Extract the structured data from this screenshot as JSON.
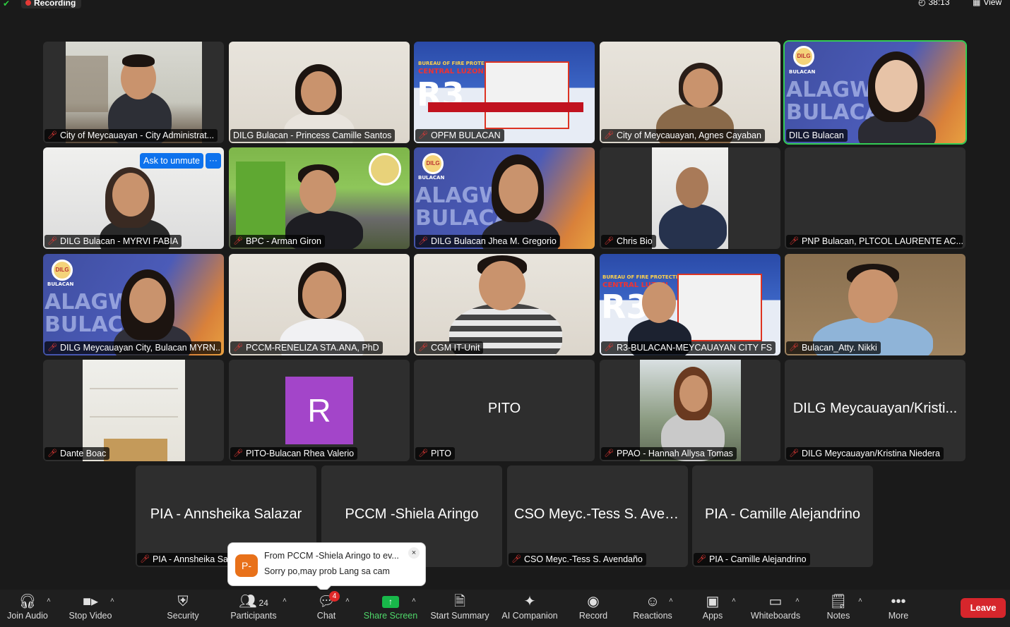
{
  "topbar": {
    "recording_label": "Recording",
    "timer": "38:13",
    "view_label": "View"
  },
  "tiles": [
    {
      "name": "City of Meycauayan - City Administrat...",
      "muted": true
    },
    {
      "name": "DILG Bulacan - Princess Camille Santos",
      "muted": false
    },
    {
      "name": "OPFM BULACAN",
      "muted": true
    },
    {
      "name": "City of Meycauayan, Agnes Cayaban",
      "muted": true
    },
    {
      "name": "DILG Bulacan",
      "muted": false,
      "active": true
    },
    {
      "name": "DILG Bulacan - MYRVI FABIA",
      "muted": true
    },
    {
      "name": "BPC - Arman Giron",
      "muted": true
    },
    {
      "name": "DILG Bulacan Jhea M. Gregorio",
      "muted": true
    },
    {
      "name": "Chris Bio",
      "muted": true
    },
    {
      "name": "PNP Bulacan, PLTCOL LAURENTE AC...",
      "muted": true
    },
    {
      "name": "DILG Meycauayan City, Bulacan MYRN...",
      "muted": true
    },
    {
      "name": "PCCM-RENELIZA STA.ANA, PhD",
      "muted": true
    },
    {
      "name": "CGM IT-Unit",
      "muted": true
    },
    {
      "name": "R3-BULACAN-MEYCAUAYAN CITY FS",
      "muted": true
    },
    {
      "name": "Bulacan_Atty. Nikki",
      "muted": true
    },
    {
      "name": "Dante Boac",
      "muted": true
    },
    {
      "name": "PITO-Bulacan Rhea Valerio",
      "muted": true,
      "avatar_letter": "R"
    },
    {
      "name": "PITO",
      "muted": true,
      "center_name": "PITO"
    },
    {
      "name": "PPAO - Hannah Allysa Tomas",
      "muted": true
    },
    {
      "name": "DILG Meycauayan/Kristina Niedera",
      "muted": true,
      "center_name": "DILG Meycauayan/Kristi..."
    },
    {
      "name": "PIA - Annsheika Sa",
      "muted": true,
      "center_name": "PIA - Annsheika Salazar"
    },
    {
      "name": "",
      "muted": false,
      "center_name": "PCCM  -Shiela Aringo"
    },
    {
      "name": "CSO Meyc.-Tess S. Avendaño",
      "muted": true,
      "center_name": "CSO Meyc.-Tess S. Aven..."
    },
    {
      "name": "PIA - Camille Alejandrino",
      "muted": true,
      "center_name": "PIA - Camille Alejandrino"
    }
  ],
  "overlays": {
    "ask_to_unmute": "Ask to unmute",
    "more_dots": "···",
    "fire_header": "BUREAU OF FIRE PROTECTION",
    "fire_region": "CENTRAL LUZON",
    "fire_big": "R3",
    "dilg_logo": "DILG",
    "dilg_sub": "BULACAN",
    "dilg_word1": "ALAGWA",
    "dilg_word2": "BULACAN"
  },
  "chat_toast": {
    "avatar": "P-",
    "title": "From PCCM  -Shiela Aringo to ev...",
    "message": "Sorry po,may prob Lang sa cam",
    "close": "×"
  },
  "toolbar": {
    "join_audio": "Join Audio",
    "stop_video": "Stop Video",
    "security": "Security",
    "participants": "Participants",
    "participants_count": "24",
    "chat": "Chat",
    "chat_badge": "4",
    "share_screen": "Share Screen",
    "start_summary": "Start Summary",
    "ai_companion": "AI Companion",
    "record": "Record",
    "reactions": "Reactions",
    "apps": "Apps",
    "whiteboards": "Whiteboards",
    "notes": "Notes",
    "more": "More",
    "leave": "Leave"
  },
  "colors": {
    "accent_blue": "#0e72ed",
    "active_green": "#33cc55",
    "share_green": "#18b84a",
    "leave_red": "#d6262c",
    "muted_red": "#e53935"
  }
}
